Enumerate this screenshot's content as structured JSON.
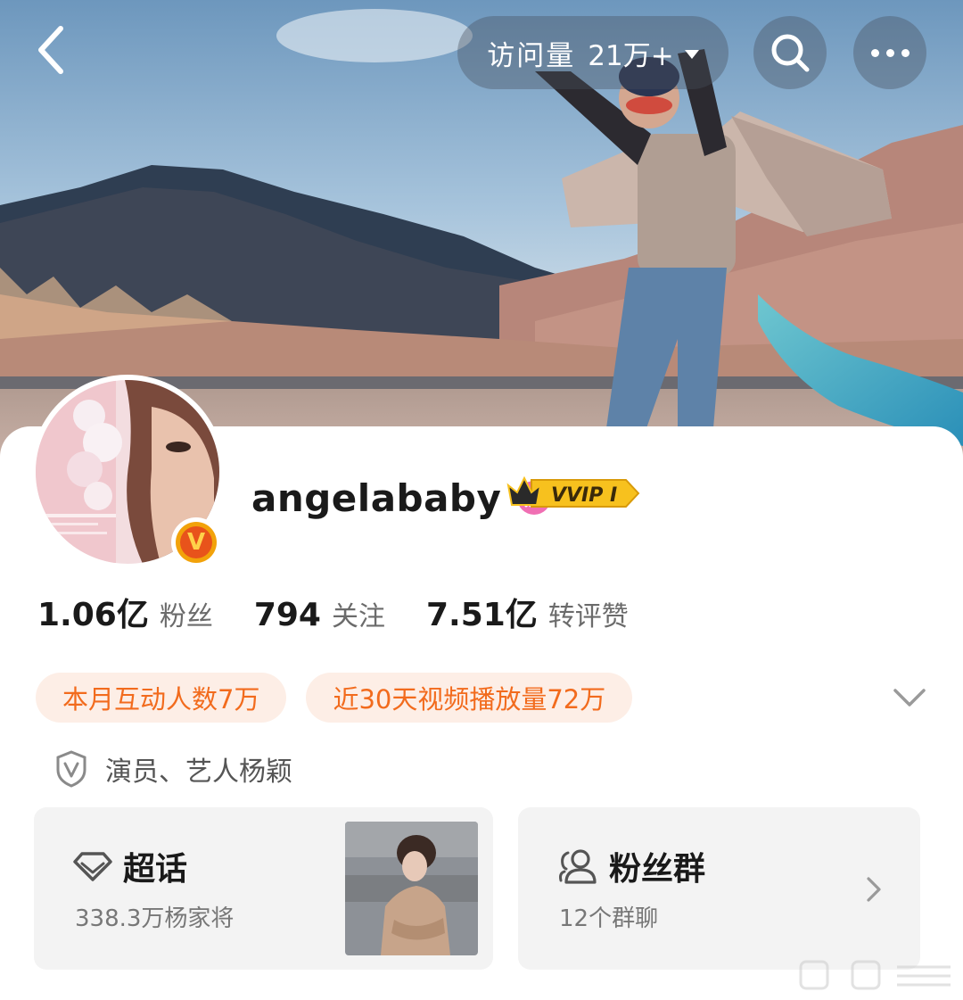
{
  "header": {
    "visits_label": "访问量",
    "visits_value": "21万+",
    "back_icon": "back-chevron-icon",
    "search_icon": "search-icon",
    "more_icon": "more-dots-icon"
  },
  "profile": {
    "name": "angelababy",
    "gender": "female",
    "vip_badge": "VVIP I",
    "verified_badge": "V",
    "stats": [
      {
        "value": "1.06亿",
        "label": "粉丝"
      },
      {
        "value": "794",
        "label": "关注"
      },
      {
        "value": "7.51亿",
        "label": "转评赞"
      }
    ],
    "tags": [
      "本月互动人数7万",
      "近30天视频播放量72万"
    ],
    "verification": "演员、艺人杨颖"
  },
  "cards": {
    "super_topic": {
      "title": "超话",
      "subtitle": "338.3万杨家将"
    },
    "fan_group": {
      "title": "粉丝群",
      "subtitle": "12个群聊"
    }
  },
  "colors": {
    "accent_orange": "#f26b1d",
    "tag_bg": "#fdeee6",
    "gender_pink": "#f06fb3",
    "vip_gold": "#f7c11e",
    "card_bg": "#f3f3f3"
  }
}
